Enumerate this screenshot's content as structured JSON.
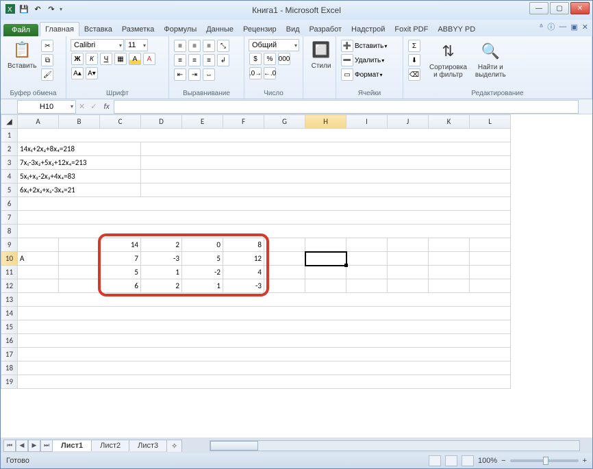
{
  "window": {
    "title": "Книга1 - Microsoft Excel"
  },
  "tabs": {
    "file": "Файл",
    "items": [
      "Главная",
      "Вставка",
      "Разметка",
      "Формулы",
      "Данные",
      "Рецензир",
      "Вид",
      "Разработ",
      "Надстрой",
      "Foxit PDF",
      "ABBYY PD"
    ],
    "active": 0
  },
  "ribbon": {
    "clipboard": {
      "label": "Буфер обмена",
      "paste": "Вставить"
    },
    "font": {
      "label": "Шрифт",
      "name": "Calibri",
      "size": "11",
      "bold": "Ж",
      "italic": "К",
      "underline": "Ч"
    },
    "align": {
      "label": "Выравнивание"
    },
    "number": {
      "label": "Число",
      "format": "Общий"
    },
    "styles": {
      "label": "",
      "btn": "Стили"
    },
    "cells": {
      "label": "Ячейки",
      "insert": "Вставить",
      "delete": "Удалить",
      "format": "Формат"
    },
    "editing": {
      "label": "Редактирование",
      "sort": "Сортировка\nи фильтр",
      "find": "Найти и\nвыделить"
    }
  },
  "namebox": "H10",
  "fx": "fx",
  "columns": [
    "A",
    "B",
    "C",
    "D",
    "E",
    "F",
    "G",
    "H",
    "I",
    "J",
    "K",
    "L"
  ],
  "rows": {
    "r1": {},
    "r2": {
      "A": "14x₁+2x₂+8x₄=218"
    },
    "r3": {
      "A": "7x₁-3x₂+5x₃+12x₄=213"
    },
    "r4": {
      "A": "5x₁+x₂-2x₃+4x₄=83"
    },
    "r5": {
      "A": "6x₁+2x₂+x₃-3x₄=21"
    },
    "r9": {
      "C": "14",
      "D": "2",
      "E": "0",
      "F": "8"
    },
    "r10": {
      "A": "A",
      "C": "7",
      "D": "-3",
      "E": "5",
      "F": "12"
    },
    "r11": {
      "C": "5",
      "D": "1",
      "E": "-2",
      "F": "4"
    },
    "r12": {
      "C": "6",
      "D": "2",
      "E": "1",
      "F": "-3"
    }
  },
  "sheets": [
    "Лист1",
    "Лист2",
    "Лист3"
  ],
  "status": {
    "ready": "Готово",
    "zoom": "100%"
  }
}
